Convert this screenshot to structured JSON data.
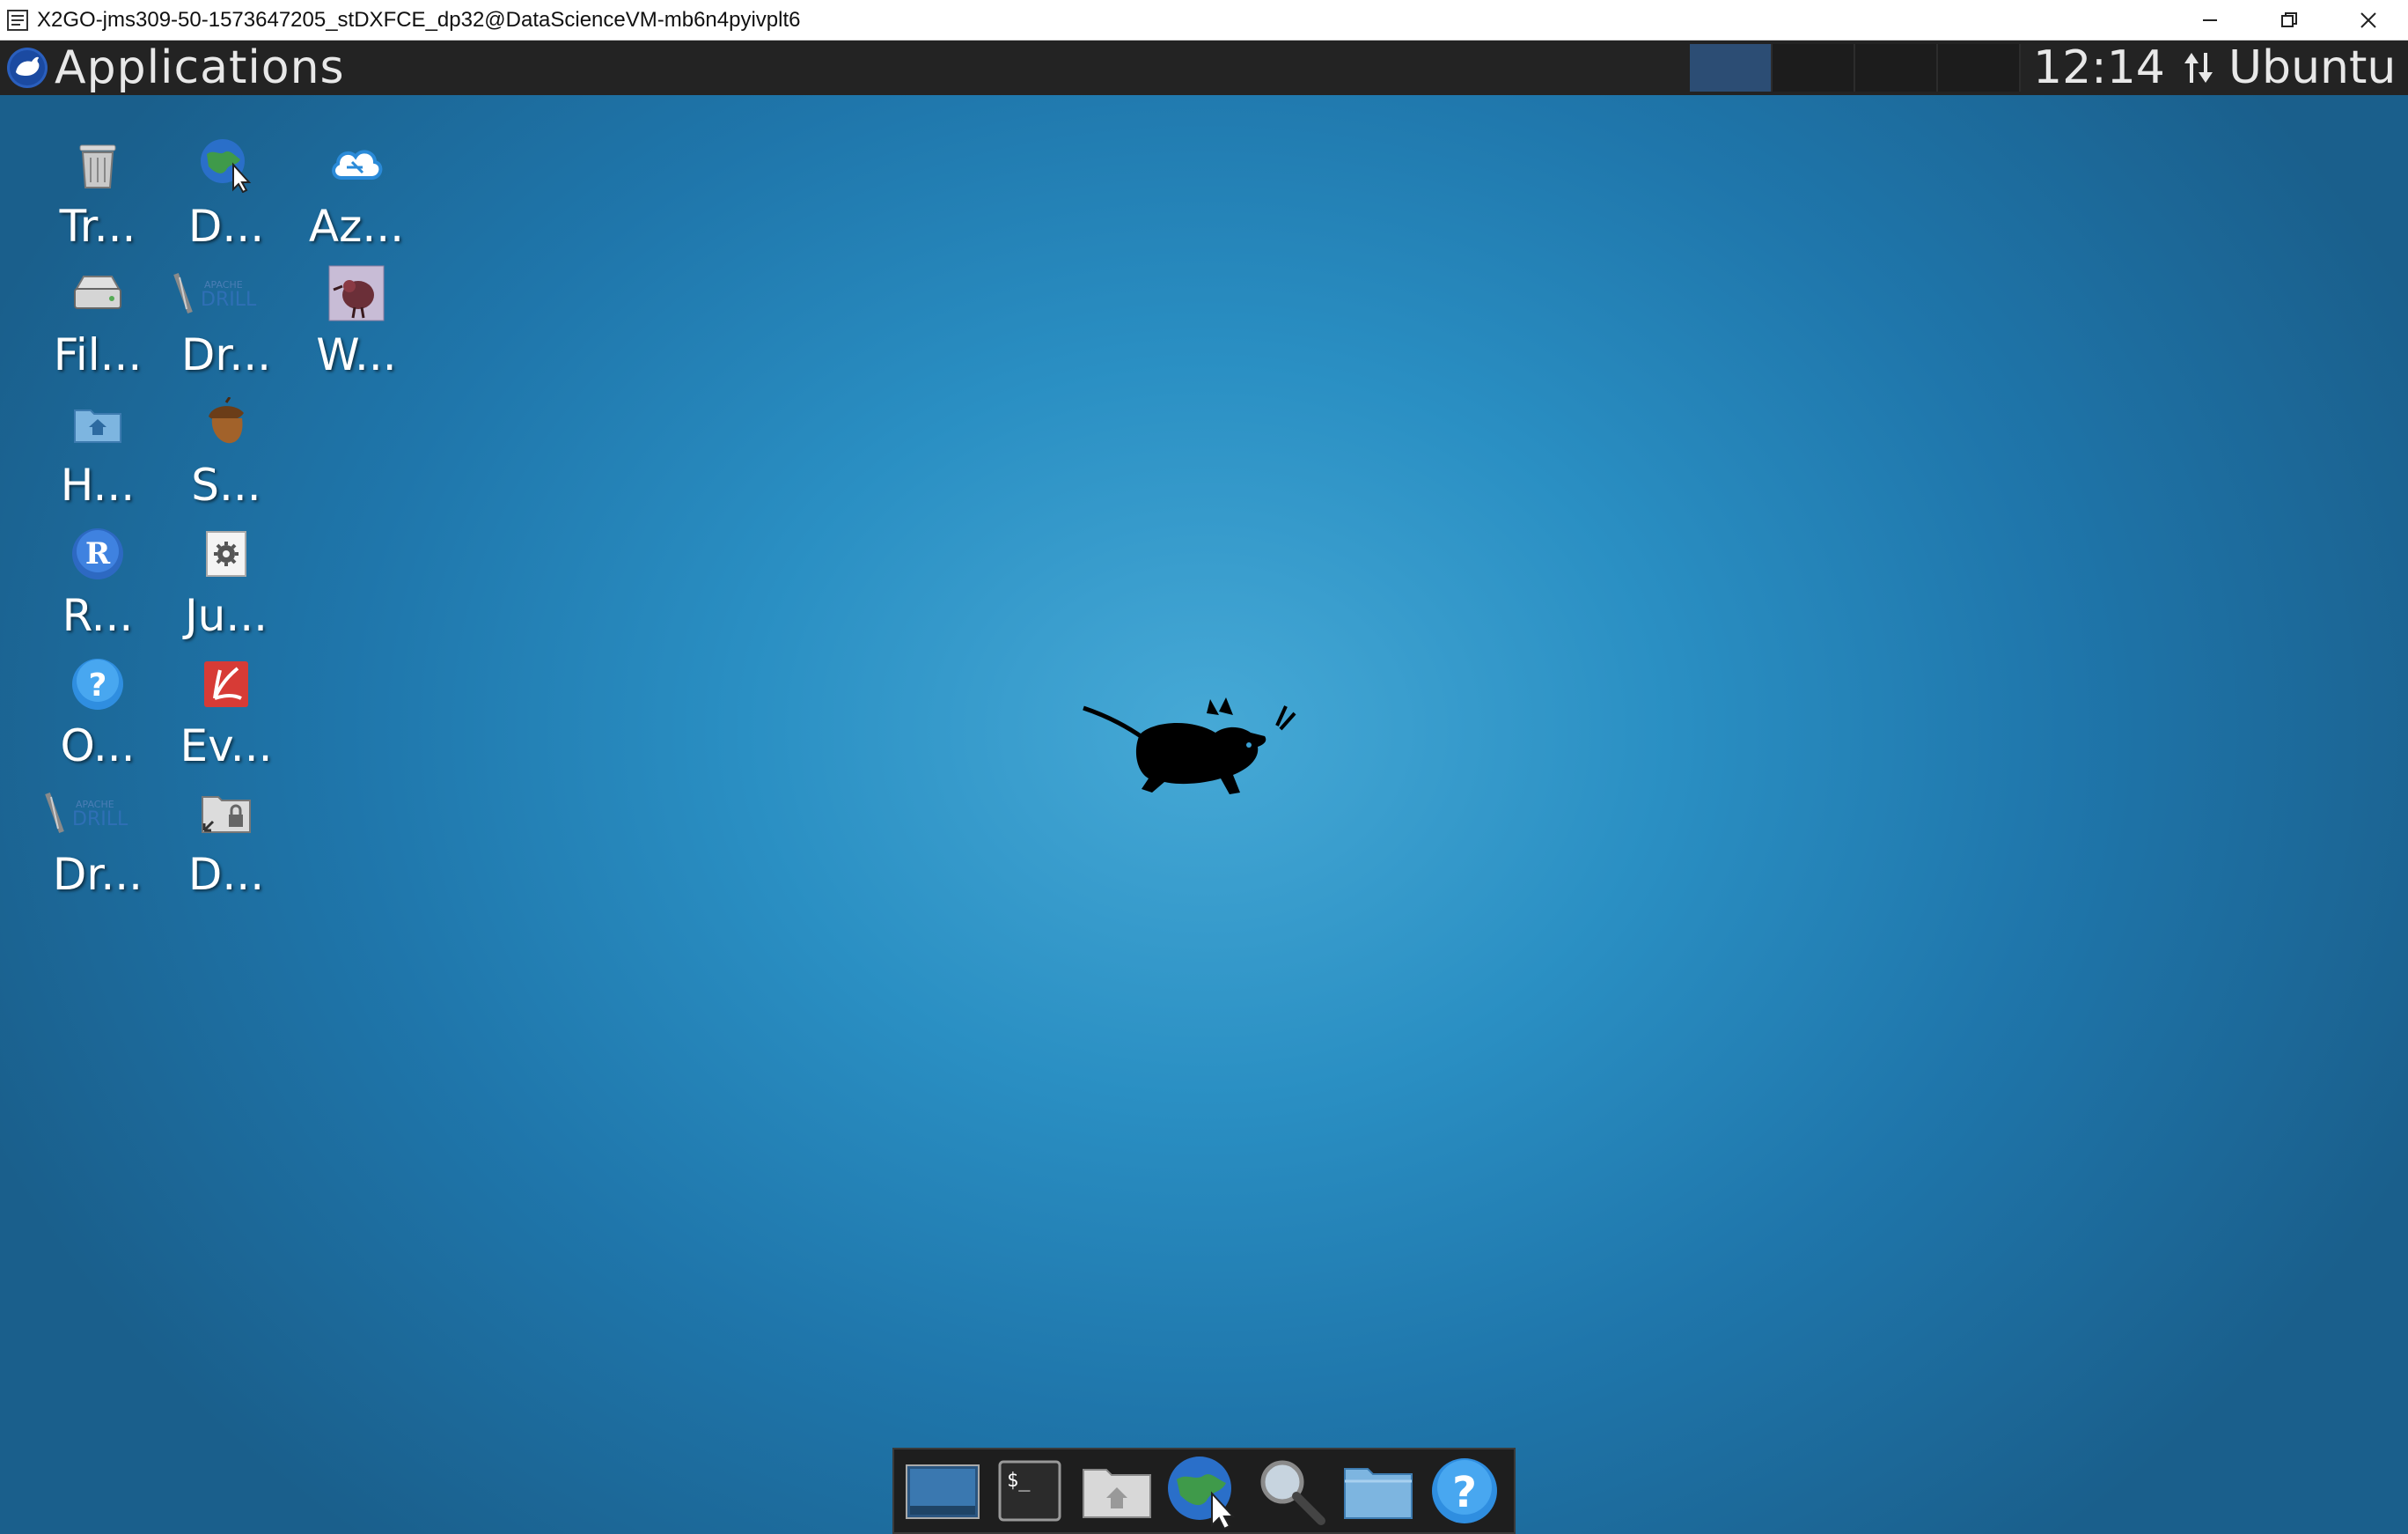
{
  "window": {
    "title": "X2GO-jms309-50-1573647205_stDXFCE_dp32@DataScienceVM-mb6n4pyivplt6",
    "icon": "x2go-window-icon",
    "controls": [
      "minimize-icon",
      "restore-icon",
      "close-icon"
    ]
  },
  "panel": {
    "menu_label": "Applications",
    "workspaces": [
      {
        "active": true
      },
      {
        "active": false
      },
      {
        "active": false
      },
      {
        "active": false
      }
    ],
    "clock": "12:14",
    "user": "Ubuntu",
    "network_icon": "network-transfer-icon"
  },
  "desktop": {
    "icons": [
      {
        "label": "Tr...",
        "icon": "trash-icon"
      },
      {
        "label": "D...",
        "icon": "web-browser-icon"
      },
      {
        "label": "Az...",
        "icon": "azure-cloud-icon"
      },
      {
        "label": "Fil...",
        "icon": "file-system-drive-icon"
      },
      {
        "label": "Dr...",
        "icon": "apache-drill-icon"
      },
      {
        "label": "W...",
        "icon": "weka-bird-icon"
      },
      {
        "label": "H...",
        "icon": "home-folder-icon"
      },
      {
        "label": "S...",
        "icon": "squirrel-acorn-icon"
      },
      {
        "label": "R...",
        "icon": "r-language-icon"
      },
      {
        "label": "Ju...",
        "icon": "jupyter-settings-icon"
      },
      {
        "label": "O...",
        "icon": "help-question-icon"
      },
      {
        "label": "Ev...",
        "icon": "evince-document-icon"
      },
      {
        "label": "Dr...",
        "icon": "apache-drill-icon"
      },
      {
        "label": "D...",
        "icon": "locked-folder-icon"
      }
    ],
    "wallpaper_accent": "#2a8fc3"
  },
  "dock": {
    "items": [
      {
        "icon": "show-desktop-icon"
      },
      {
        "icon": "terminal-icon"
      },
      {
        "icon": "home-folder-icon"
      },
      {
        "icon": "web-browser-icon"
      },
      {
        "icon": "search-magnifier-icon"
      },
      {
        "icon": "files-folder-icon"
      },
      {
        "icon": "help-question-icon"
      }
    ]
  }
}
